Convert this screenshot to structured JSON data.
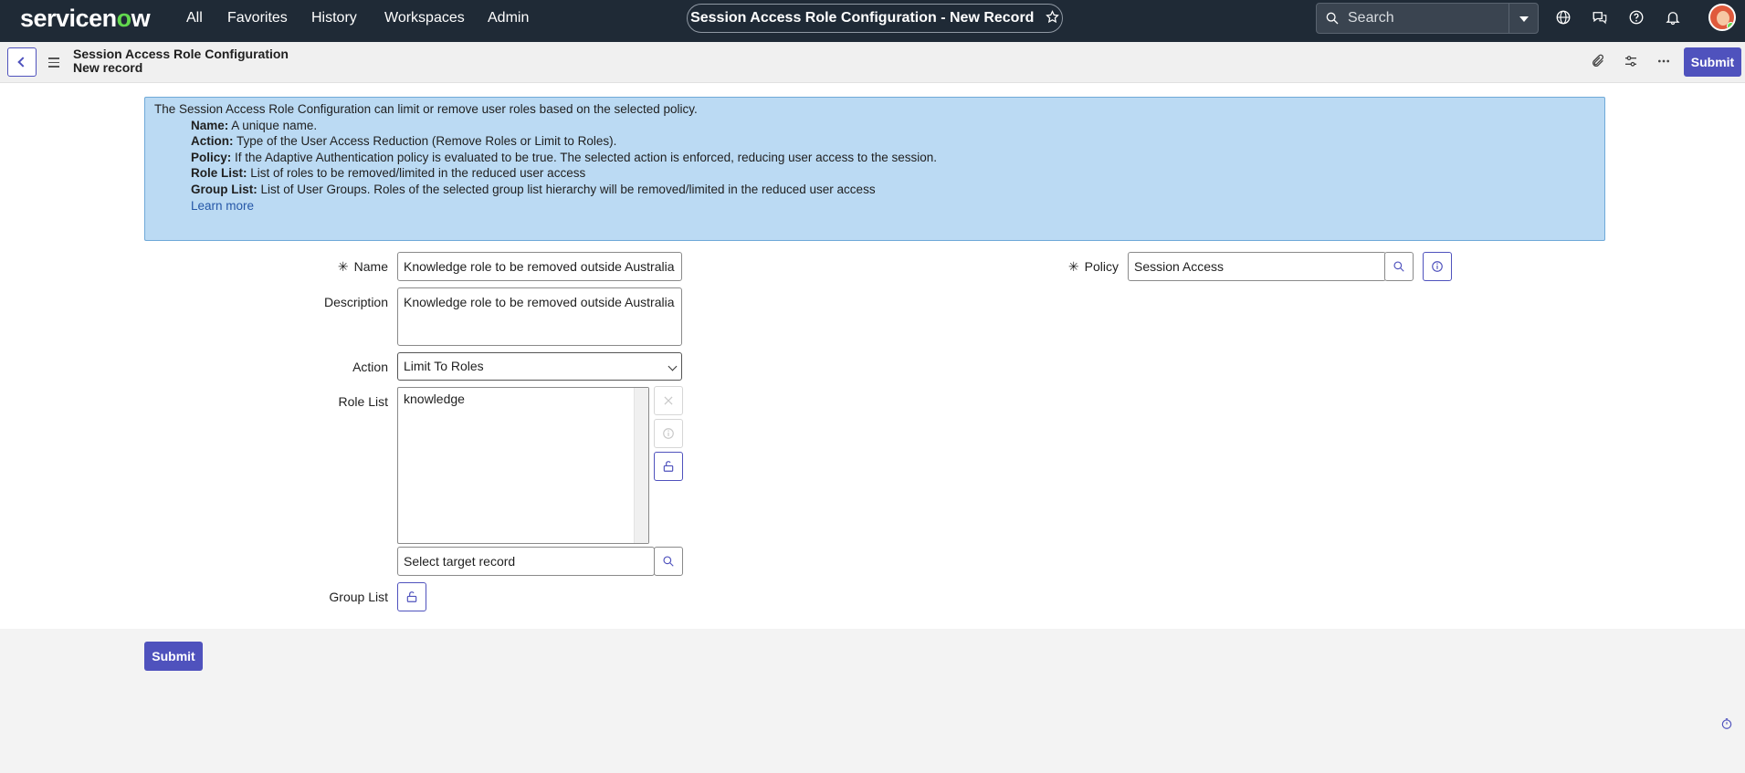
{
  "topnav": {
    "logo": {
      "part1": "servicen",
      "part2": "o",
      "part3": "w"
    },
    "links": [
      "All",
      "Favorites",
      "History",
      "Workspaces",
      "Admin"
    ],
    "record_title": "Session Access Role Configuration - New Record",
    "search_placeholder": "Search",
    "icons": [
      "globe-icon",
      "chat-icon",
      "help-icon",
      "bell-icon",
      "avatar"
    ]
  },
  "header": {
    "title": "Session Access Role Configuration",
    "subtitle": "New record",
    "submit_label": "Submit",
    "icons": [
      "back-icon",
      "menu-icon",
      "paperclip-icon",
      "settings-sliders-icon",
      "more-icon"
    ]
  },
  "info": {
    "intro": "The Session Access Role Configuration can limit or remove user roles based on the selected policy.",
    "items": [
      {
        "term": "Name:",
        "text": " A unique name."
      },
      {
        "term": "Action:",
        "text": " Type of the User Access Reduction (Remove Roles or Limit to Roles)."
      },
      {
        "term": "Policy:",
        "text": " If the Adaptive Authentication policy is evaluated to be true. The selected action is enforced, reducing user access to the session."
      },
      {
        "term": "Role List:",
        "text": " List of roles to be removed/limited in the reduced user access"
      },
      {
        "term": "Group List:",
        "text": " List of User Groups. Roles of the selected group list hierarchy will be removed/limited in the reduced user access"
      }
    ],
    "learn_more": "Learn more"
  },
  "form": {
    "name_label": "Name",
    "name_value": "Knowledge role to be removed outside Australia",
    "description_label": "Description",
    "description_value": "Knowledge role to be removed outside Australia",
    "action_label": "Action",
    "action_value": "Limit To Roles",
    "role_list_label": "Role List",
    "role_list_items": [
      "knowledge"
    ],
    "target_placeholder": "Select target record",
    "group_list_label": "Group List",
    "policy_label": "Policy",
    "policy_value": "Session Access",
    "required_mark": "✳"
  },
  "footer": {
    "submit_label": "Submit"
  },
  "colors": {
    "nav_bg": "#1f2a36",
    "accent": "#4f52bd",
    "info_bg": "#bbdaf3",
    "logo_green": "#62d84e"
  }
}
